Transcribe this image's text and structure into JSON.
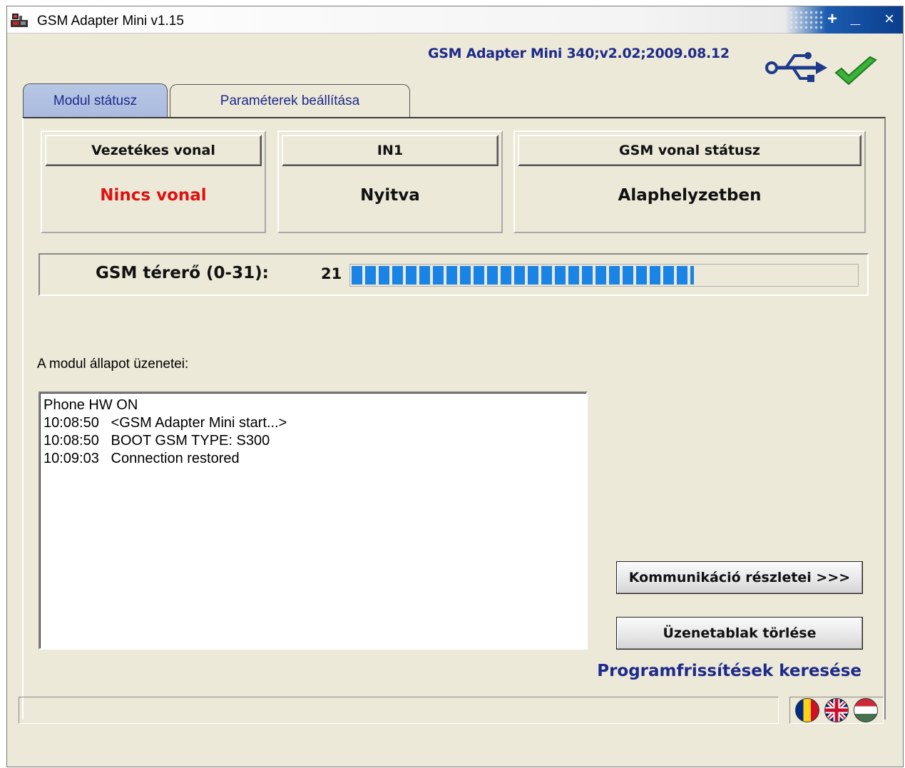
{
  "window": {
    "title": "GSM Adapter Mini v1.15",
    "controls": {
      "plus": "+",
      "minimize": "_",
      "close": "×"
    }
  },
  "header": {
    "device_info": "GSM Adapter Mini 340;v2.02;2009.08.12",
    "connection_icon": "usb-icon",
    "connection_status_icon": "check-icon"
  },
  "tabs": [
    {
      "label": "Modul státusz",
      "active": true
    },
    {
      "label": "Paraméterek beállítása",
      "active": false
    }
  ],
  "status": {
    "wired_line": {
      "title": "Vezetékes vonal",
      "value": "Nincs vonal",
      "color": "#e01010"
    },
    "in1": {
      "title": "IN1",
      "value": "Nyitva"
    },
    "gsm_line": {
      "title": "GSM vonal státusz",
      "value": "Alaphelyzetben"
    }
  },
  "signal": {
    "label": "GSM térerő (0-31):",
    "value": "21",
    "level": 21,
    "max": 31,
    "color": "#1a84e6"
  },
  "messages": {
    "label": "A modul állapot üzenetei:",
    "lines": [
      "Phone HW ON",
      "10:08:50   <GSM Adapter Mini start...>",
      "10:08:50   BOOT GSM TYPE: S300",
      "10:09:03   Connection restored"
    ]
  },
  "buttons": {
    "communication_details": "Kommunikáció részletei >>>",
    "clear_messages": "Üzenetablak törlése"
  },
  "update_link": "Programfrissítések keresése",
  "languages": [
    "flag-ro-icon",
    "flag-gb-icon",
    "flag-hu-icon"
  ]
}
